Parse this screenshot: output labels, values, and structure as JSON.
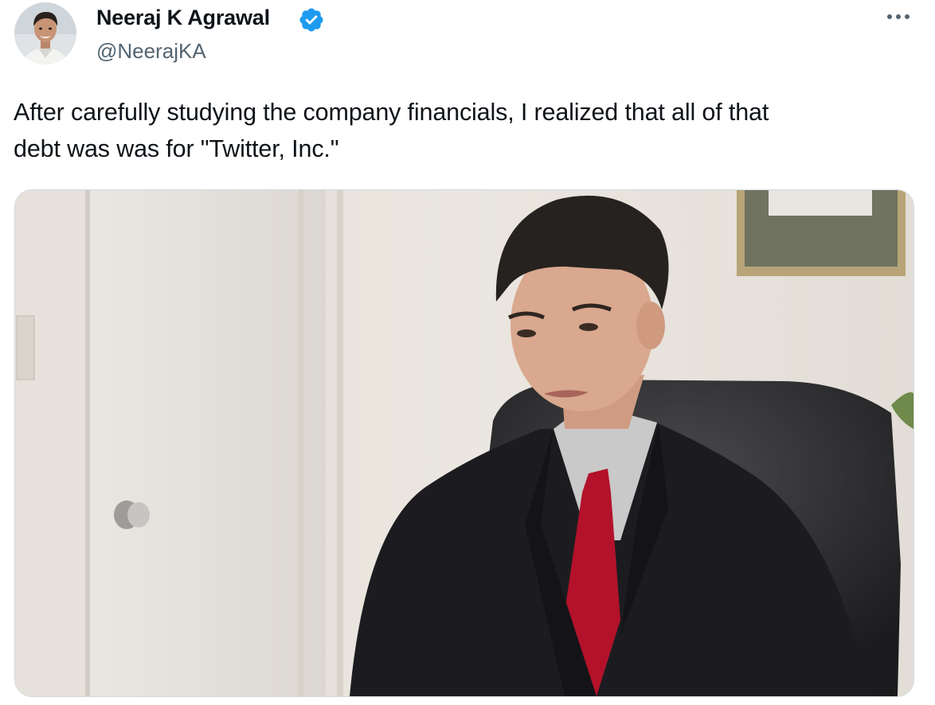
{
  "tweet": {
    "author": {
      "display_name": "Neeraj K Agrawal",
      "handle": "@NeerajKA",
      "verified": true,
      "verified_icon": "verified-badge-icon",
      "verified_color": "#1d9bf0"
    },
    "text_lines": [
      "After carefully studying the company financials, I realized that all of that",
      "debt was was for \"Twitter, Inc.\""
    ],
    "more_icon": "more-options-icon",
    "media": {
      "kind": "photo"
    }
  },
  "colors": {
    "text": "#0f1419",
    "secondary": "#536471",
    "border": "#cfd9de",
    "accent": "#1d9bf0"
  }
}
